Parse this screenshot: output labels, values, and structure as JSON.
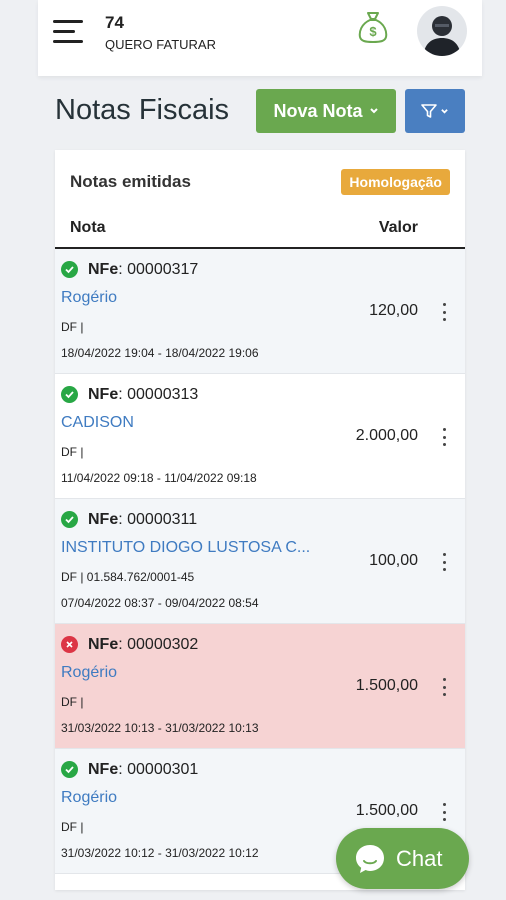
{
  "header": {
    "company_number": "74",
    "company_name": "QUERO FATURAR",
    "icons": [
      "menu-icon",
      "money-bag-icon",
      "user-avatar"
    ]
  },
  "page": {
    "title": "Notas Fiscais",
    "new_button": "Nova Nota",
    "filter_icon": "filter-icon"
  },
  "card": {
    "title": "Notas emitidas",
    "badge": "Homologação",
    "col_nota": "Nota",
    "col_valor": "Valor"
  },
  "notes": [
    {
      "status": "ok",
      "type": "NFe",
      "number": ": 00000317",
      "client": "Rogério",
      "loc": "DF |",
      "dates": "18/04/2022 19:04 - 18/04/2022 19:06",
      "value": "120,00"
    },
    {
      "status": "ok",
      "type": "NFe",
      "number": ": 00000313",
      "client": "CADISON",
      "loc": "DF |",
      "dates": "11/04/2022 09:18 - 11/04/2022 09:18",
      "value": "2.000,00"
    },
    {
      "status": "ok",
      "type": "NFe",
      "number": ": 00000311",
      "client": "INSTITUTO DIOGO LUSTOSA C...",
      "loc": "DF | 01.584.762/0001-45",
      "dates": "07/04/2022 08:37 - 09/04/2022 08:54",
      "value": "100,00"
    },
    {
      "status": "error",
      "type": "NFe",
      "number": ": 00000302",
      "client": "Rogério",
      "loc": "DF |",
      "dates": "31/03/2022 10:13 - 31/03/2022 10:13",
      "value": "1.500,00"
    },
    {
      "status": "ok",
      "type": "NFe",
      "number": ": 00000301",
      "client": "Rogério",
      "loc": "DF |",
      "dates": "31/03/2022 10:12 - 31/03/2022 10:12",
      "value": "1.500,00"
    }
  ],
  "chat": {
    "label": "Chat"
  },
  "colors": {
    "primary_green": "#6aa84f",
    "primary_blue": "#4a7fc1",
    "badge_orange": "#e8a93c",
    "error_bg": "#f6d3d3",
    "link_blue": "#3f7bc1"
  }
}
